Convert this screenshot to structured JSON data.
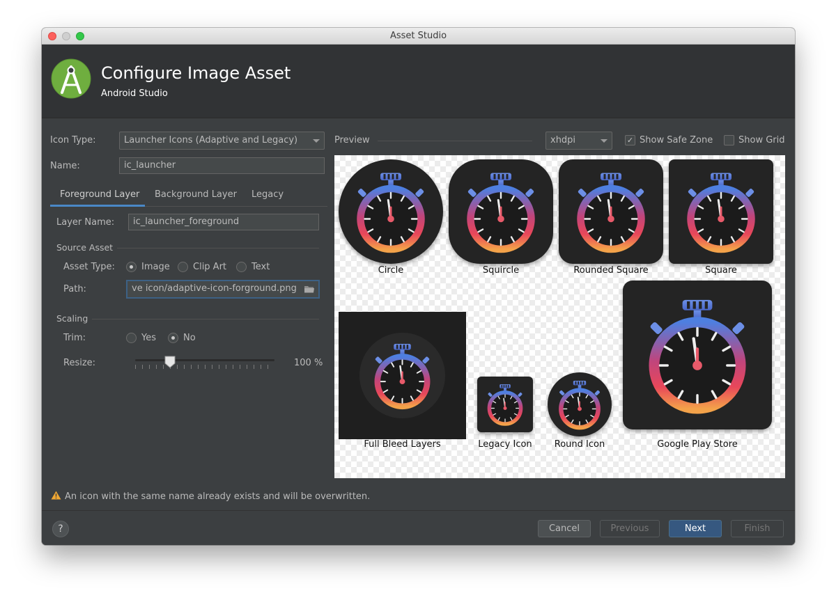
{
  "window": {
    "title": "Asset Studio"
  },
  "header": {
    "title": "Configure Image Asset",
    "subtitle": "Android Studio"
  },
  "form": {
    "icon_type_label": "Icon Type:",
    "icon_type_value": "Launcher Icons (Adaptive and Legacy)",
    "name_label": "Name:",
    "name_value": "ic_launcher",
    "tabs": [
      "Foreground Layer",
      "Background Layer",
      "Legacy"
    ],
    "selected_tab": "Foreground Layer",
    "layer_name_label": "Layer Name:",
    "layer_name_value": "ic_launcher_foreground",
    "source_asset_heading": "Source Asset",
    "asset_type_label": "Asset Type:",
    "asset_type_options": [
      "Image",
      "Clip Art",
      "Text"
    ],
    "asset_type_selected": "Image",
    "path_label": "Path:",
    "path_value": "ve icon/adaptive-icon-forground.png",
    "scaling_heading": "Scaling",
    "trim_label": "Trim:",
    "trim_options": [
      "Yes",
      "No"
    ],
    "trim_selected": "No",
    "resize_label": "Resize:",
    "resize_value": "100 %"
  },
  "preview": {
    "heading": "Preview",
    "density_value": "xhdpi",
    "show_safe_zone_label": "Show Safe Zone",
    "show_safe_zone_checked": true,
    "show_grid_label": "Show Grid",
    "show_grid_checked": false,
    "items": [
      "Circle",
      "Squircle",
      "Rounded Square",
      "Square",
      "Full Bleed Layers",
      "Legacy Icon",
      "Round Icon",
      "Google Play Store"
    ]
  },
  "warning": {
    "text": "An icon with the same name already exists and will be overwritten.",
    "icon": "warning-icon"
  },
  "footer": {
    "help": "?",
    "cancel": "Cancel",
    "previous": "Previous",
    "next": "Next",
    "finish": "Finish"
  },
  "colors": {
    "accent": "#4a88c7",
    "primary_button": "#365880",
    "panel": "#3c3f41",
    "header": "#313335"
  }
}
